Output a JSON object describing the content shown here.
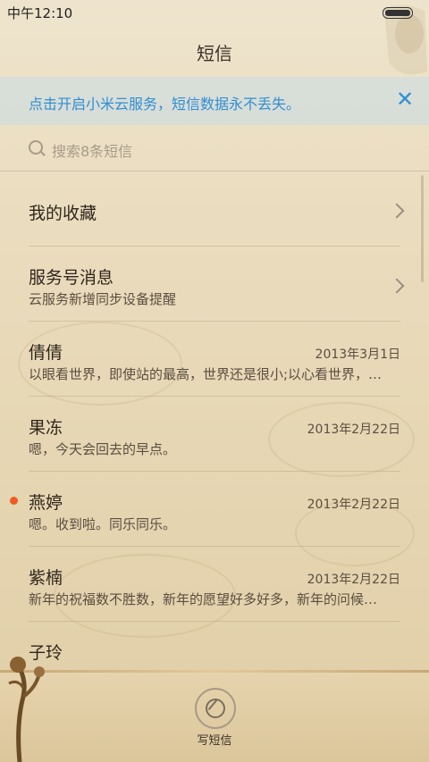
{
  "status_bar": {
    "time": "中午12:10"
  },
  "header": {
    "title": "短信"
  },
  "banner": {
    "text": "点击开启小米云服务，短信数据永不丢失。",
    "close_icon": "close-icon"
  },
  "search": {
    "placeholder": "搜索8条短信"
  },
  "list": [
    {
      "name": "我的收藏",
      "type": "folder"
    },
    {
      "name": "服务号消息",
      "sub": "云服务新增同步设备提醒",
      "type": "folder"
    },
    {
      "name": "倩倩",
      "date": "2013年3月1日",
      "sub": "以眼看世界，即使站的最高，世界还是很小;以心看世界，…"
    },
    {
      "name": "果冻",
      "date": "2013年2月22日",
      "sub": "嗯，今天会回去的早点。"
    },
    {
      "name": "燕婷",
      "date": "2013年2月22日",
      "sub": "嗯。收到啦。同乐同乐。",
      "unread": true
    },
    {
      "name": "紫楠",
      "date": "2013年2月22日",
      "sub": "新年的祝福数不胜数，新年的愿望好多好多，新年的问候…"
    },
    {
      "name": "子玲"
    }
  ],
  "bottom_bar": {
    "compose_label": "写短信"
  },
  "colors": {
    "accent": "#2f8fd4",
    "unread": "#ee5a24",
    "background": "#eadcbe"
  }
}
